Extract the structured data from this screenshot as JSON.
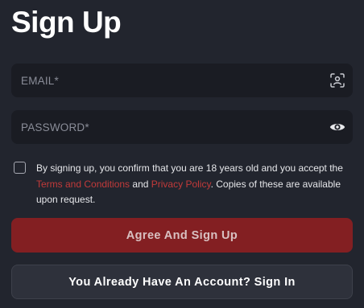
{
  "page": {
    "title": "Sign Up"
  },
  "form": {
    "email": {
      "placeholder": "EMAIL*",
      "value": "",
      "icon": "face-scan-icon"
    },
    "password": {
      "placeholder": "PASSWORD*",
      "value": "",
      "icon": "eye-icon"
    },
    "consent": {
      "checked": false,
      "text_before": "By signing up, you confirm that you are 18 years old and you accept the ",
      "terms_link": "Terms and Conditions",
      "text_and": " and ",
      "privacy_link": "Privacy Policy",
      "text_after": ". Copies of these are available upon request."
    },
    "submit_label": "Agree And Sign Up",
    "signin_label": "You Already Have An Account? Sign In"
  },
  "colors": {
    "background": "#22252e",
    "field_background": "#1a1c23",
    "accent": "#831f22",
    "link": "#c23a3a"
  }
}
